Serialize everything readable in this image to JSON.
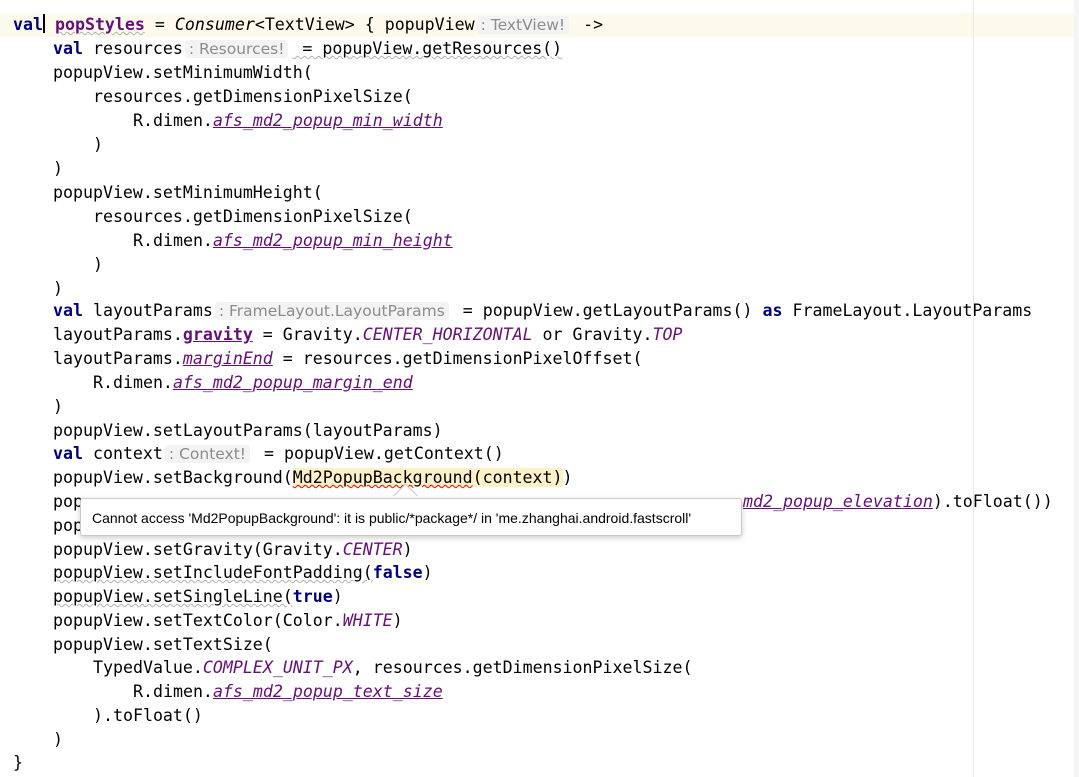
{
  "editor": {
    "hints": {
      "popupView_type": ": TextView!",
      "resources_type": ": Resources!",
      "layoutParams_type": ": FrameLayout.LayoutParams",
      "context_type": ": Context!"
    },
    "lines": {
      "l1_kw": "val",
      "l1_name": "popStyles",
      "l1_type": "Consumer",
      "l1_rest": "<TextView> { popupView",
      "l1_arrow": " ->",
      "l2_kw": "val",
      "l2_a": " resources",
      "l2_b": " = popupView.getResources()",
      "l3": "popupView.setMinimumWidth(",
      "l4": "resources.getDimensionPixelSize(",
      "l5_a": "R.dimen.",
      "l5_b": "afs_md2_popup_min_width",
      "l6": ")",
      "l7": ")",
      "l8": "popupView.setMinimumHeight(",
      "l9": "resources.getDimensionPixelSize(",
      "l10_a": "R.dimen.",
      "l10_b": "afs_md2_popup_min_height",
      "l11": ")",
      "l12": ")",
      "l13_kw": "val",
      "l13_a": " layoutParams",
      "l13_b": " = popupView.getLayoutParams() ",
      "l13_as": "as",
      "l13_c": " FrameLayout.LayoutParams",
      "l14_a": "layoutParams.",
      "l14_b": "gravity",
      "l14_c": " = Gravity.",
      "l14_d": "CENTER_HORIZONTAL",
      "l14_e": " or Gravity.",
      "l14_f": "TOP",
      "l15_a": "layoutParams.",
      "l15_b": "marginEnd",
      "l15_c": " = resources.getDimensionPixelOffset(",
      "l16_a": "R.dimen.",
      "l16_b": "afs_md2_popup_margin_end",
      "l17": ")",
      "l18": "popupView.setLayoutParams(layoutParams)",
      "l19_kw": "val",
      "l19_a": " context",
      "l19_b": " = popupView.getContext()",
      "l20_a": "popupView.setBackground(",
      "l20_b": "Md2PopupBackground",
      "l20_c": "(context)",
      "l20_d": ")",
      "l21_a": "pop",
      "l21_b": "md2_popup_elevation",
      "l21_c": ").toFloat())",
      "l22": "pop",
      "l23_a": "popupView.setGravity(Gravity.",
      "l23_b": "CENTER",
      "l23_c": ")",
      "l24_a": "popupView.setIncludeFontPadding(",
      "l24_b": "false",
      "l24_c": ")",
      "l25_a": "popupView.setSingleLine(",
      "l25_b": "true",
      "l25_c": ")",
      "l26_a": "popupView.setTextColor(Color.",
      "l26_b": "WHITE",
      "l26_c": ")",
      "l27": "popupView.setTextSize(",
      "l28_a": "TypedValue.",
      "l28_b": "COMPLEX_UNIT_PX",
      "l28_c": ", resources.getDimensionPixelSize(",
      "l29_a": "R.dimen.",
      "l29_b": "afs_md2_popup_text_size",
      "l30": ").toFloat()",
      "l31": ")",
      "l32": "}"
    }
  },
  "tooltip": {
    "message": "Cannot access 'Md2PopupBackground': it is public/*package*/ in 'me.zhanghai.android.fastscroll'"
  }
}
